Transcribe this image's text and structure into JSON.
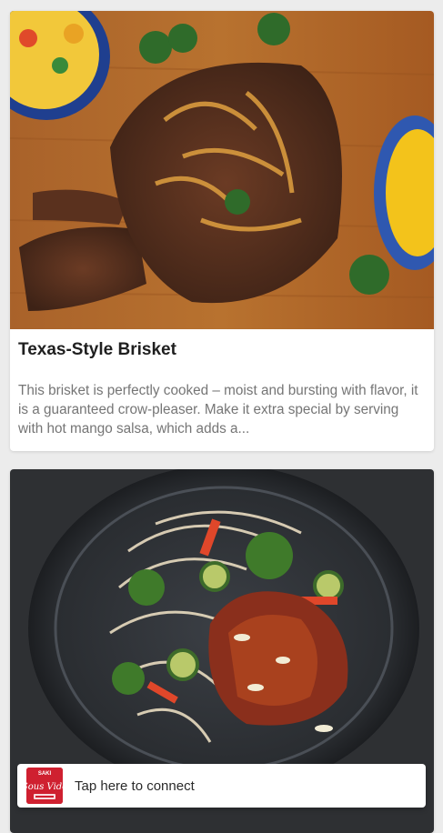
{
  "feed": {
    "cards": [
      {
        "title": "Texas-Style Brisket",
        "description": "This brisket is perfectly cooked – moist and bursting with flavor, it is a guaranteed crow-pleaser. Make it extra special by serving with hot mango salsa, which adds a..."
      },
      {
        "title": "",
        "description": ""
      }
    ]
  },
  "connect_bar": {
    "label": "Tap here to connect",
    "logo_brand": "SAKI",
    "logo_text": "Sous Vide"
  },
  "colors": {
    "background": "#ececec",
    "card": "#ffffff",
    "title_text": "#1f1f1f",
    "description_text": "#757575",
    "logo_red": "#cf2030"
  }
}
